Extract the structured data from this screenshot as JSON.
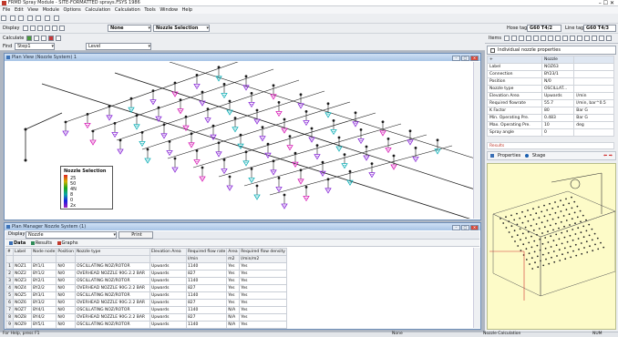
{
  "window": {
    "title": "FRMD Spray Module - SITE-FORMATTED sprays.FSYS 1986",
    "controls": "– ☐ ✕"
  },
  "menu": [
    "File",
    "Edit",
    "View",
    "Module",
    "Options",
    "Calculation",
    "Calculation",
    "Tools",
    "Window",
    "Help"
  ],
  "toolbar2": {
    "display_label": "Display",
    "display_value": "None",
    "nozzle_value": "Nozzle Selection",
    "hose_label": "Hose tag:",
    "hose_value": "G60 T4/2",
    "line_label": "Line tag:",
    "line_value": "G60 T4/3"
  },
  "toolbar3": {
    "calc_label": "Calculate",
    "view_label": "Items"
  },
  "toolbar4": {
    "find_label": "Find",
    "find_value": "Step1",
    "level_value": "Level"
  },
  "plan_window": {
    "title": "Plan View (Nozzle System) 1"
  },
  "legend": {
    "title": "Nozzle Selection",
    "items": [
      "25",
      "50",
      "4N",
      "8",
      "0",
      "2x"
    ]
  },
  "grid_window": {
    "title": "Plan Manager Nozzle System (1)",
    "filter_label": "Display",
    "filter_value": "Nozzle",
    "print_label": "Print",
    "tabs": [
      "Data",
      "Results",
      "Graphs"
    ],
    "columns": [
      "#",
      "Label",
      "Node node",
      "Position",
      "Nozzle type",
      "Elevation Area",
      "Required flow rate",
      "Area",
      "Required flow density"
    ],
    "subheaders": [
      "",
      "",
      "",
      "",
      "",
      "",
      "l/min",
      "m2",
      "l/min/m2"
    ],
    "rows": [
      [
        "1",
        "NOZ1",
        "BY1/1",
        "N/0",
        "OSCILLATING NOZ/ROTOR",
        "Upwards",
        "1140",
        "Yes",
        "Yes"
      ],
      [
        "2",
        "NOZ2",
        "BY1/2",
        "N/0",
        "OVERHEAD NOZZLE 90G 2.2 BAR",
        "Upwards",
        "827",
        "Yes",
        "Yes"
      ],
      [
        "3",
        "NOZ3",
        "BY2/1",
        "N/0",
        "OSCILLATING NOZ/ROTOR",
        "Upwards",
        "1140",
        "Yes",
        "Yes"
      ],
      [
        "4",
        "NOZ4",
        "BY2/2",
        "N/0",
        "OVERHEAD NOZZLE 90G 2.2 BAR",
        "Upwards",
        "827",
        "Yes",
        "Yes"
      ],
      [
        "5",
        "NOZ5",
        "BY3/1",
        "N/0",
        "OSCILLATING NOZ/ROTOR",
        "Upwards",
        "1140",
        "Yes",
        "Yes"
      ],
      [
        "6",
        "NOZ6",
        "BY3/2",
        "N/0",
        "OVERHEAD NOZZLE 90G 2.2 BAR",
        "Upwards",
        "827",
        "Yes",
        "Yes"
      ],
      [
        "7",
        "NOZ7",
        "BY4/1",
        "N/0",
        "OSCILLATING NOZ/ROTOR",
        "Upwards",
        "1140",
        "N/A",
        "Yes"
      ],
      [
        "8",
        "NOZ8",
        "BY4/2",
        "N/0",
        "OVERHEAD NOZZLE 90G 2.2 BAR",
        "Upwards",
        "827",
        "N/A",
        "Yes"
      ],
      [
        "9",
        "NOZ9",
        "BY5/1",
        "N/0",
        "OSCILLATING NOZ/ROTOR",
        "Upwards",
        "1140",
        "N/A",
        "Yes"
      ]
    ]
  },
  "properties": {
    "header": "Individual nozzle properties",
    "title_row": "Nozzle",
    "rows": [
      [
        "Label",
        "NOZ63"
      ],
      [
        "Connection",
        "BY23/1"
      ],
      [
        "Position",
        "N/0"
      ],
      [
        "Nozzle type",
        "OSCILLAT..."
      ],
      [
        "Elevation Area",
        "Upwards"
      ],
      [
        "Required flowrate",
        "55.7"
      ],
      [
        "K Factor",
        "80"
      ],
      [
        "Min. Operating Pre.",
        "0.483"
      ],
      [
        "Max. Operating Pre.",
        "10"
      ],
      [
        "Spray angle",
        "0"
      ]
    ],
    "units": [
      "",
      "",
      "",
      "",
      "",
      "l/min",
      "l/min, bar^0.5",
      "Bar G",
      "Bar G",
      "deg"
    ],
    "section_label": "Results"
  },
  "panel_tabs": [
    "Properties",
    "Stage"
  ],
  "status": {
    "left": "For Help, press F1",
    "mid": "None",
    "right1": "Nozzle Calculation",
    "right2": "NUM"
  },
  "colors": {
    "nozzle_purple": "#8a2bd8",
    "nozzle_magenta": "#d81bb6",
    "nozzle_cyan": "#12b0b8",
    "pipe": "#1a1a1a",
    "preview_bg": "#fdfbc8"
  }
}
